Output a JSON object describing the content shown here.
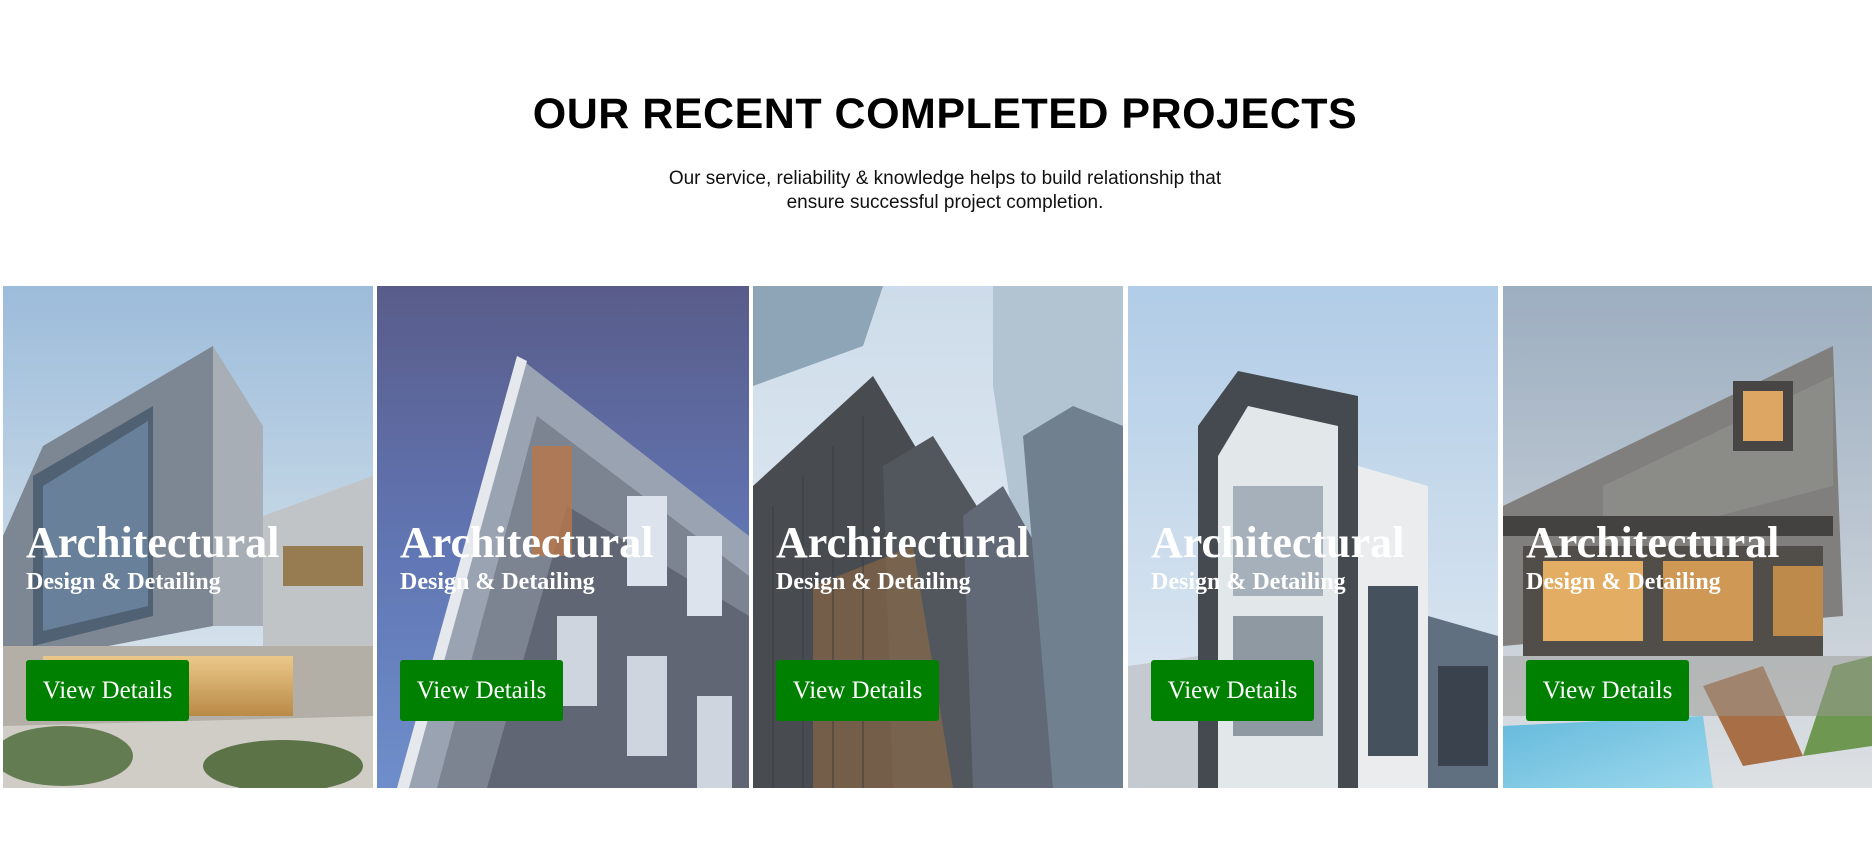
{
  "section": {
    "title": "OUR RECENT COMPLETED PROJECTS",
    "subtitle_line1": "Our service, reliability & knowledge helps to build relationship that",
    "subtitle_line2": "ensure successful project completion."
  },
  "projects": [
    {
      "title": "Architectural",
      "subtitle": "Design & Detailing",
      "button_label": "View Details"
    },
    {
      "title": "Architectural",
      "subtitle": "Design & Detailing",
      "button_label": "View Details"
    },
    {
      "title": "Architectural",
      "subtitle": "Design & Detailing",
      "button_label": "View Details"
    },
    {
      "title": "Architectural",
      "subtitle": "Design & Detailing",
      "button_label": "View Details"
    },
    {
      "title": "Architectural",
      "subtitle": "Design & Detailing",
      "button_label": "View Details"
    }
  ],
  "colors": {
    "button_background": "#008000",
    "button_text": "#ffffff",
    "overlay_text": "#ffffff",
    "heading_text": "#000000"
  }
}
